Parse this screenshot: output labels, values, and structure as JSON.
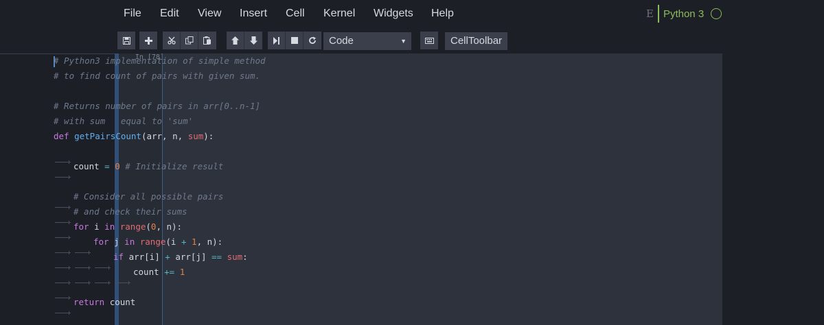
{
  "menu": [
    "File",
    "Edit",
    "View",
    "Insert",
    "Cell",
    "Kernel",
    "Widgets",
    "Help"
  ],
  "kernel": {
    "logo_letter": "E",
    "name": "Python 3",
    "status": "idle"
  },
  "toolbar": {
    "buttons": [
      "save-icon",
      "plus-icon",
      "cut-icon",
      "copy-icon",
      "paste-icon",
      "arrow-up-icon",
      "arrow-down-icon",
      "run-icon",
      "stop-icon",
      "restart-icon"
    ],
    "cell_type": "Code",
    "keyboard_icon": "keyboard-icon",
    "celltoolbar_label": "CellToolbar"
  },
  "cell": {
    "prompt": "In [78]:",
    "lines": [
      [
        [
          0,
          "c",
          "# Python3 implementation of simple method"
        ]
      ],
      [
        [
          0,
          "c",
          "# to find count of pairs with given sum."
        ]
      ],
      [],
      [
        [
          0,
          "c",
          "# Returns number of pairs in arr[0..n-1]"
        ]
      ],
      [
        [
          0,
          "c",
          "# with sum   equal to 'sum'"
        ]
      ],
      [
        [
          0,
          "k",
          "def "
        ],
        [
          0,
          "f",
          "getPairsCount"
        ],
        [
          0,
          "v",
          "(arr, n, "
        ],
        [
          0,
          "p",
          "sum"
        ],
        [
          0,
          "v",
          "):"
        ]
      ],
      [
        [
          1,
          "",
          ""
        ]
      ],
      [
        [
          1,
          "",
          ""
        ],
        [
          0,
          "v",
          "count "
        ],
        [
          0,
          "o",
          "= "
        ],
        [
          0,
          "n",
          "0"
        ],
        [
          0,
          "c",
          " # Initialize result"
        ]
      ],
      [],
      [
        [
          1,
          "",
          ""
        ],
        [
          0,
          "c",
          "# Consider all possible pairs"
        ]
      ],
      [
        [
          1,
          "",
          ""
        ],
        [
          0,
          "c",
          "# and check their sums"
        ]
      ],
      [
        [
          1,
          "",
          ""
        ],
        [
          0,
          "k",
          "for "
        ],
        [
          0,
          "v",
          "i "
        ],
        [
          0,
          "k",
          "in "
        ],
        [
          0,
          "p",
          "range"
        ],
        [
          0,
          "v",
          "("
        ],
        [
          0,
          "n",
          "0"
        ],
        [
          0,
          "v",
          ", n):"
        ]
      ],
      [
        [
          2,
          "",
          ""
        ],
        [
          0,
          "k",
          "for "
        ],
        [
          0,
          "v",
          "j "
        ],
        [
          0,
          "k",
          "in "
        ],
        [
          0,
          "p",
          "range"
        ],
        [
          0,
          "v",
          "(i "
        ],
        [
          0,
          "o",
          "+ "
        ],
        [
          0,
          "n",
          "1"
        ],
        [
          0,
          "v",
          ", n):"
        ]
      ],
      [
        [
          3,
          "",
          ""
        ],
        [
          0,
          "k",
          "if "
        ],
        [
          0,
          "v",
          "arr[i] "
        ],
        [
          0,
          "o",
          "+ "
        ],
        [
          0,
          "v",
          "arr[j] "
        ],
        [
          0,
          "o",
          "== "
        ],
        [
          0,
          "p",
          "sum"
        ],
        [
          0,
          "v",
          ":"
        ]
      ],
      [
        [
          4,
          "",
          ""
        ],
        [
          0,
          "v",
          "count "
        ],
        [
          0,
          "o",
          "+= "
        ],
        [
          0,
          "n",
          "1"
        ]
      ],
      [
        [
          1,
          "",
          ""
        ]
      ],
      [
        [
          1,
          "",
          ""
        ],
        [
          0,
          "k",
          "return "
        ],
        [
          0,
          "v",
          "count"
        ]
      ]
    ]
  }
}
